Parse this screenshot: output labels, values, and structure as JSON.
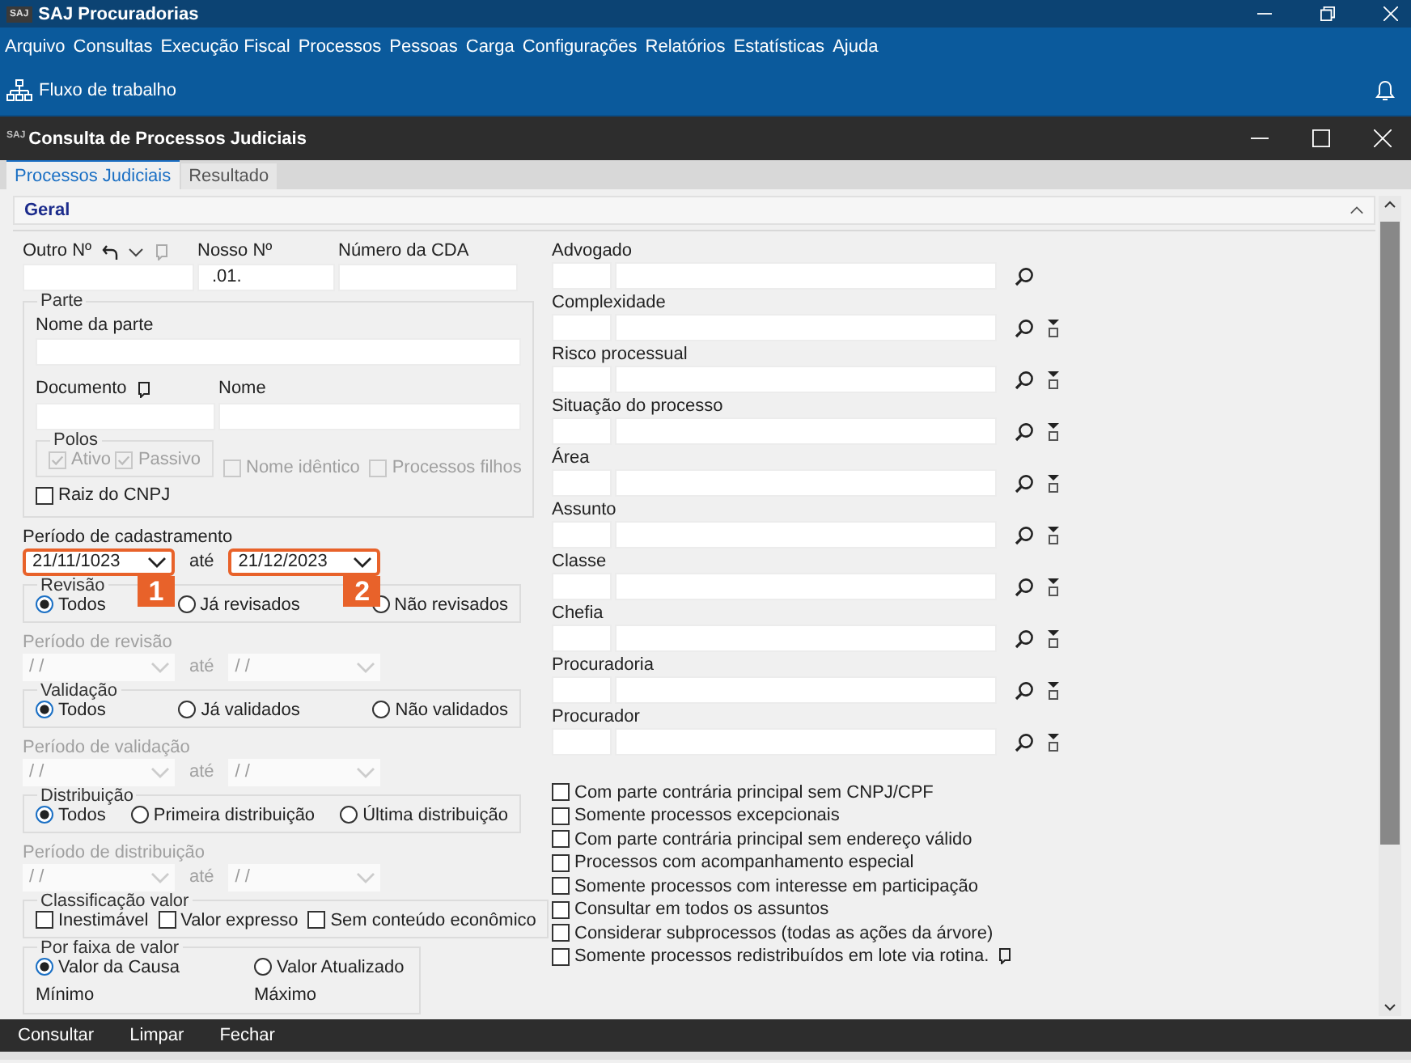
{
  "app": {
    "logo": "SAJ",
    "title": "SAJ Procuradorias"
  },
  "menu": [
    "Arquivo",
    "Consultas",
    "Execução Fiscal",
    "Processos",
    "Pessoas",
    "Carga",
    "Configurações",
    "Relatórios",
    "Estatísticas",
    "Ajuda"
  ],
  "toolbar": {
    "workflow": "Fluxo de trabalho"
  },
  "window": {
    "logo": "SAJ",
    "title": "Consulta de Processos Judiciais"
  },
  "tabs": [
    {
      "label": "Processos Judiciais",
      "selected": true
    },
    {
      "label": "Resultado",
      "selected": false
    }
  ],
  "section": {
    "title": "Geral"
  },
  "numbers": [
    {
      "label": "Outro Nº",
      "kind": "tools"
    },
    {
      "label": "Nosso Nº",
      "value": ".01.",
      "kind": "plain"
    },
    {
      "label": "Número da CDA",
      "kind": "plain"
    }
  ],
  "parte": {
    "title": "Parte",
    "name_label": "Nome da parte",
    "document_label": "Documento",
    "nome_label": "Nome",
    "polos": {
      "title": "Polos",
      "options": [
        {
          "label": "Ativo",
          "checked": true,
          "disabled": true
        },
        {
          "label": "Passivo",
          "checked": true,
          "disabled": true
        }
      ]
    },
    "options": [
      {
        "label": "Nome idêntico",
        "checked": false,
        "disabled": true
      },
      {
        "label": "Processos filhos",
        "checked": false,
        "disabled": true
      }
    ],
    "raiz": {
      "label": "Raiz do CNPJ",
      "checked": false,
      "disabled": false
    }
  },
  "cadastro": {
    "label": "Período de cadastramento",
    "until": "até",
    "disabled": false,
    "from": {
      "value": "21/11/1023",
      "callout": "1"
    },
    "to": {
      "value": "21/12/2023",
      "callout": "2"
    }
  },
  "filters": [
    {
      "title": "Revisão",
      "options": [
        {
          "label": "Todos",
          "selected": true
        },
        {
          "label": "Já revisados",
          "selected": false
        },
        {
          "label": "Não revisados",
          "selected": false
        }
      ],
      "period": {
        "label": "Período de revisão",
        "until": "até",
        "disabled": true,
        "from": {
          "value": "/ /"
        },
        "to": {
          "value": "/ /"
        }
      }
    },
    {
      "title": "Validação",
      "options": [
        {
          "label": "Todos",
          "selected": true
        },
        {
          "label": "Já validados",
          "selected": false
        },
        {
          "label": "Não validados",
          "selected": false
        }
      ],
      "period": {
        "label": "Período de validação",
        "until": "até",
        "disabled": true,
        "from": {
          "value": "/ /"
        },
        "to": {
          "value": "/ /"
        }
      }
    },
    {
      "title": "Distribuição",
      "options": [
        {
          "label": "Todos",
          "selected": true
        },
        {
          "label": "Primeira distribuição",
          "selected": false
        },
        {
          "label": "Última distribuição",
          "selected": false
        }
      ],
      "period": {
        "label": "Período de distribuição",
        "until": "até",
        "disabled": true,
        "from": {
          "value": "/ /"
        },
        "to": {
          "value": "/ /"
        }
      }
    }
  ],
  "classificacao": {
    "title": "Classificação valor",
    "options": [
      {
        "label": "Inestimável",
        "checked": false
      },
      {
        "label": "Valor expresso",
        "checked": false
      },
      {
        "label": "Sem conteúdo econômico",
        "checked": false
      }
    ]
  },
  "faixa": {
    "title": "Por faixa de valor",
    "options": [
      {
        "label": "Valor da Causa",
        "selected": true
      },
      {
        "label": "Valor Atualizado",
        "selected": false
      }
    ],
    "min_label": "Mínimo",
    "max_label": "Máximo"
  },
  "lookups": [
    {
      "label": "Advogado",
      "filter": false
    },
    {
      "label": "Complexidade",
      "filter": true
    },
    {
      "label": "Risco processual",
      "filter": true
    },
    {
      "label": "Situação do processo",
      "filter": true
    },
    {
      "label": "Área",
      "filter": true
    },
    {
      "label": "Assunto",
      "filter": true
    },
    {
      "label": "Classe",
      "filter": true
    },
    {
      "label": "Chefia",
      "filter": true
    },
    {
      "label": "Procuradoria",
      "filter": true
    },
    {
      "label": "Procurador",
      "filter": true
    }
  ],
  "flags": [
    {
      "label": "Com parte contrária principal sem CNPJ/CPF",
      "checked": false,
      "note": false
    },
    {
      "label": "Somente processos excepcionais",
      "checked": false,
      "note": false
    },
    {
      "label": "Com parte contrária principal sem endereço válido",
      "checked": false,
      "note": false
    },
    {
      "label": "Processos com acompanhamento especial",
      "checked": false,
      "note": false
    },
    {
      "label": "Somente processos com interesse em participação",
      "checked": false,
      "note": false
    },
    {
      "label": "Consultar em todos os assuntos",
      "checked": false,
      "note": false
    },
    {
      "label": "Considerar subprocessos (todas as ações da árvore)",
      "checked": false,
      "note": false
    },
    {
      "label": "Somente processos redistribuídos em lote via rotina.",
      "checked": false,
      "note": true
    }
  ],
  "footer": [
    "Consultar",
    "Limpar",
    "Fechar"
  ]
}
